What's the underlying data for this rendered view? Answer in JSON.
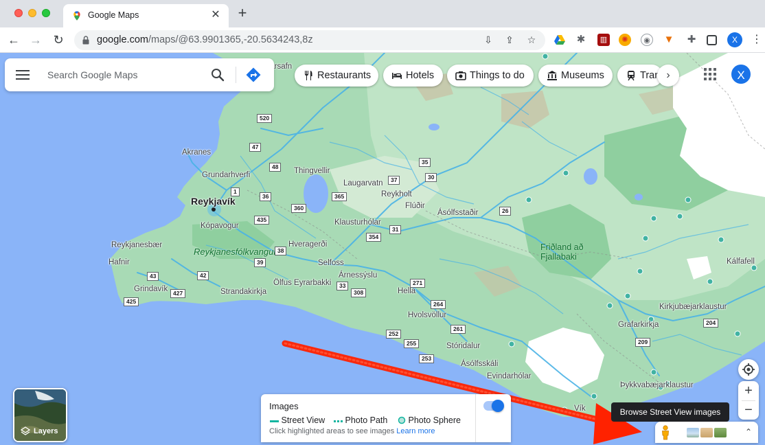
{
  "browser": {
    "tab_title": "Google Maps",
    "tab_close": "✕",
    "new_tab": "+",
    "url_host": "google.com",
    "url_path": "/maps/@63.9901365,-20.5634243,8z",
    "profile_initial": "X",
    "menu": "⋮",
    "extensions": [
      "drive-icon",
      "bug-icon",
      "red-square-icon",
      "pinwheel-icon",
      "eye-icon",
      "fox-icon",
      "puzzle-icon",
      "sidepanel-icon"
    ]
  },
  "search": {
    "placeholder": "Search Google Maps"
  },
  "chips": [
    {
      "label": "Restaurants",
      "icon": "fork-knife-icon"
    },
    {
      "label": "Hotels",
      "icon": "bed-icon"
    },
    {
      "label": "Things to do",
      "icon": "camera-icon"
    },
    {
      "label": "Museums",
      "icon": "museum-icon"
    },
    {
      "label": "Tran",
      "icon": "train-icon"
    }
  ],
  "account": {
    "initial": "X"
  },
  "map": {
    "places": [
      "Arbaejarsafn",
      "Akranes",
      "Grundarhverfi",
      "Reykjavík",
      "Kópavogur",
      "Thingvellir",
      "Laugarvatn",
      "Reykholt",
      "Flúðir",
      "Ásólfsstaðir",
      "Klausturhólar",
      "Hveragerði",
      "Reykjanesbær",
      "Hafnir",
      "Reykjanesfólkvangur",
      "Selfoss",
      "Árnessýslu",
      "Ölfus Eyrarbakki",
      "Grindavík",
      "Strandakirkja",
      "Hella",
      "Hvolsvöllur",
      "Stóridalur",
      "Ásólfsskáli",
      "Evindarhólar",
      "Fjallabaki",
      "Friðland að",
      "Kálfafell",
      "Kirkjubæjarklaustur",
      "Grafarkirkja",
      "Þykkvabæjarklaustur",
      "Vík"
    ],
    "road_numbers": [
      "520",
      "47",
      "48",
      "1",
      "36",
      "360",
      "435",
      "365",
      "37",
      "35",
      "30",
      "31",
      "354",
      "26",
      "38",
      "39",
      "42",
      "43",
      "427",
      "425",
      "33",
      "308",
      "271",
      "264",
      "261",
      "252",
      "255",
      "253",
      "204",
      "209"
    ]
  },
  "layers": {
    "label": "Layers"
  },
  "images_panel": {
    "title": "Images",
    "legend": [
      "Street View",
      "Photo Path",
      "Photo Sphere"
    ],
    "note": "Click highlighted areas to see images",
    "link": "Learn more",
    "toggle_on": true
  },
  "controls": {
    "zoom_in": "+",
    "zoom_out": "−",
    "tooltip": "Browse Street View images",
    "expand": "⌃"
  },
  "colors": {
    "water": "#8ab4f8",
    "land": "#a8dab5",
    "accent": "#1a73e8",
    "annotation_arrow": "#ff2200"
  }
}
